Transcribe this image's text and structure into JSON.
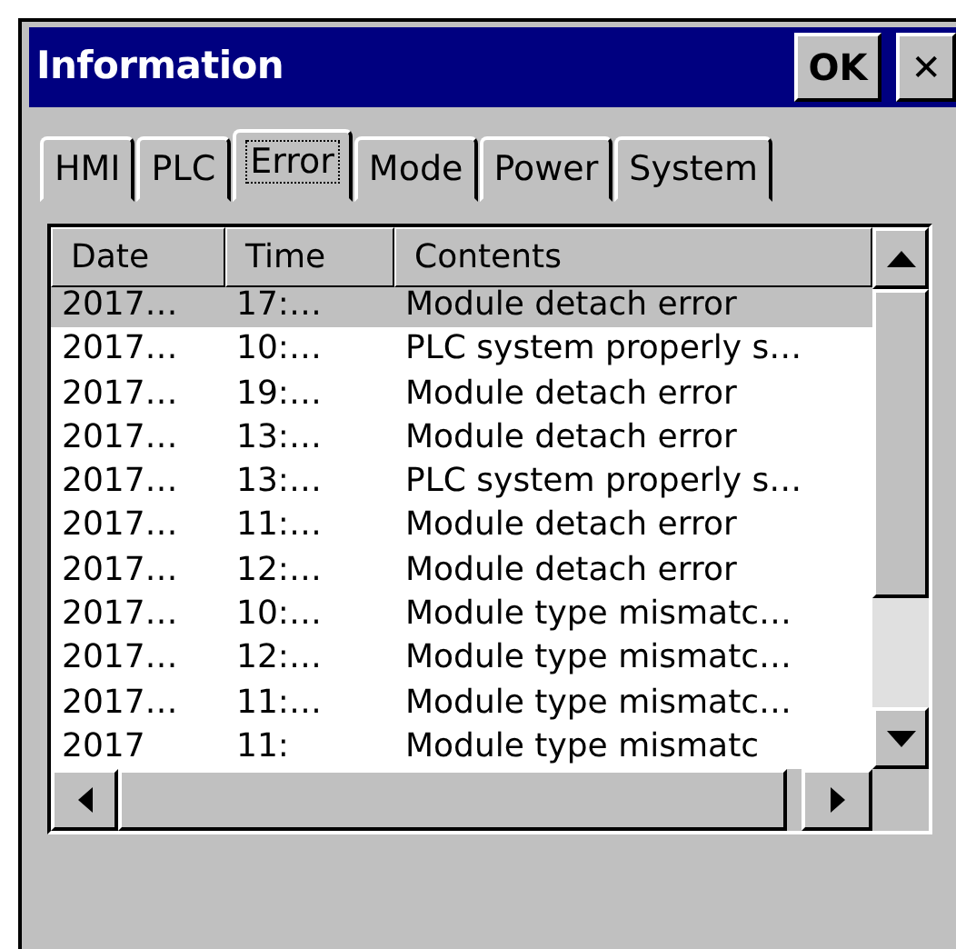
{
  "window": {
    "title": "Information",
    "ok_button": "OK",
    "close_button": "✕"
  },
  "tabs": [
    {
      "label": "HMI",
      "selected": false
    },
    {
      "label": "PLC",
      "selected": false
    },
    {
      "label": "Error",
      "selected": true
    },
    {
      "label": "Mode",
      "selected": false
    },
    {
      "label": "Power",
      "selected": false
    },
    {
      "label": "System",
      "selected": false
    }
  ],
  "table": {
    "columns": [
      "Date",
      "Time",
      "Contents"
    ],
    "rows": [
      {
        "cells": [
          "2017…",
          "17:…",
          "Module detach error"
        ],
        "selected": true
      },
      {
        "cells": [
          "2017…",
          "10:…",
          "PLC system properly s…"
        ],
        "selected": false
      },
      {
        "cells": [
          "2017…",
          "19:…",
          "Module detach error"
        ],
        "selected": false
      },
      {
        "cells": [
          "2017…",
          "13:…",
          "Module detach error"
        ],
        "selected": false
      },
      {
        "cells": [
          "2017…",
          "13:…",
          "PLC system properly s…"
        ],
        "selected": false
      },
      {
        "cells": [
          "2017…",
          "11:…",
          "Module detach error"
        ],
        "selected": false
      },
      {
        "cells": [
          "2017…",
          "12:…",
          "Module detach error"
        ],
        "selected": false
      },
      {
        "cells": [
          "2017…",
          "10:…",
          "Module type mismatc…"
        ],
        "selected": false
      },
      {
        "cells": [
          "2017…",
          "12:…",
          "Module type mismatc…"
        ],
        "selected": false
      },
      {
        "cells": [
          "2017…",
          "11:…",
          "Module type mismatc…"
        ],
        "selected": false
      },
      {
        "cells": [
          "2017",
          "11:",
          "Module type mismatc"
        ],
        "selected": false
      }
    ]
  }
}
